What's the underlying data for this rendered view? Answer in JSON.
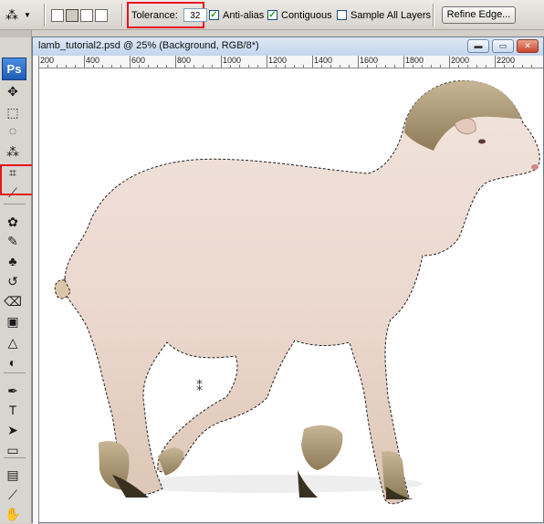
{
  "options_bar": {
    "tool_preset_icon": "magic-wand-icon",
    "selection_modes": [
      "new-selection",
      "add-to-selection",
      "subtract-from-selection",
      "intersect-selection"
    ],
    "tolerance_label": "Tolerance:",
    "tolerance_value": "32",
    "anti_alias_label": "Anti-alias",
    "anti_alias_checked": true,
    "contiguous_label": "Contiguous",
    "contiguous_checked": true,
    "sample_all_layers_label": "Sample All Layers",
    "sample_all_layers_checked": false,
    "refine_edge_label": "Refine Edge...",
    "check_mark": "✓"
  },
  "tools_panel": {
    "logo": "Ps",
    "active_tool": "magic-wand-icon",
    "tools": [
      {
        "name": "move-tool-icon",
        "glyph": "✥"
      },
      {
        "name": "marquee-tool-icon",
        "glyph": "⬚"
      },
      {
        "name": "lasso-tool-icon",
        "glyph": "◌"
      },
      {
        "name": "magic-wand-tool-icon",
        "glyph": "⁂"
      },
      {
        "name": "crop-tool-icon",
        "glyph": "⌗"
      },
      {
        "name": "eyedropper-tool-icon",
        "glyph": "⟋"
      },
      {
        "name": "healing-brush-tool-icon",
        "glyph": "✿"
      },
      {
        "name": "brush-tool-icon",
        "glyph": "✎"
      },
      {
        "name": "clone-stamp-tool-icon",
        "glyph": "♣"
      },
      {
        "name": "history-brush-tool-icon",
        "glyph": "↺"
      },
      {
        "name": "eraser-tool-icon",
        "glyph": "⌫"
      },
      {
        "name": "gradient-tool-icon",
        "glyph": "▣"
      },
      {
        "name": "blur-tool-icon",
        "glyph": "△"
      },
      {
        "name": "dodge-tool-icon",
        "glyph": "◐"
      },
      {
        "name": "pen-tool-icon",
        "glyph": "✒"
      },
      {
        "name": "type-tool-icon",
        "glyph": "T"
      },
      {
        "name": "path-selection-tool-icon",
        "glyph": "➤"
      },
      {
        "name": "shape-tool-icon",
        "glyph": "▭"
      },
      {
        "name": "notes-tool-icon",
        "glyph": "▤"
      },
      {
        "name": "eyedropper2-tool-icon",
        "glyph": "⟋"
      },
      {
        "name": "hand-tool-icon",
        "glyph": "✋"
      }
    ]
  },
  "document": {
    "title": "lamb_tutorial2.psd @ 25% (Background, RGB/8*)",
    "ruler_labels": [
      "200",
      "400",
      "600",
      "800",
      "1000",
      "1200",
      "1400",
      "1600",
      "1800",
      "2000",
      "2200"
    ],
    "minimize_glyph": "▬",
    "maximize_glyph": "▭",
    "close_glyph": "✕",
    "cursor_glyph": "⁑"
  },
  "colors": {
    "highlight": "#e8141a",
    "lamb_body": "#eedcd2",
    "lamb_wool": "#b8a27a"
  }
}
